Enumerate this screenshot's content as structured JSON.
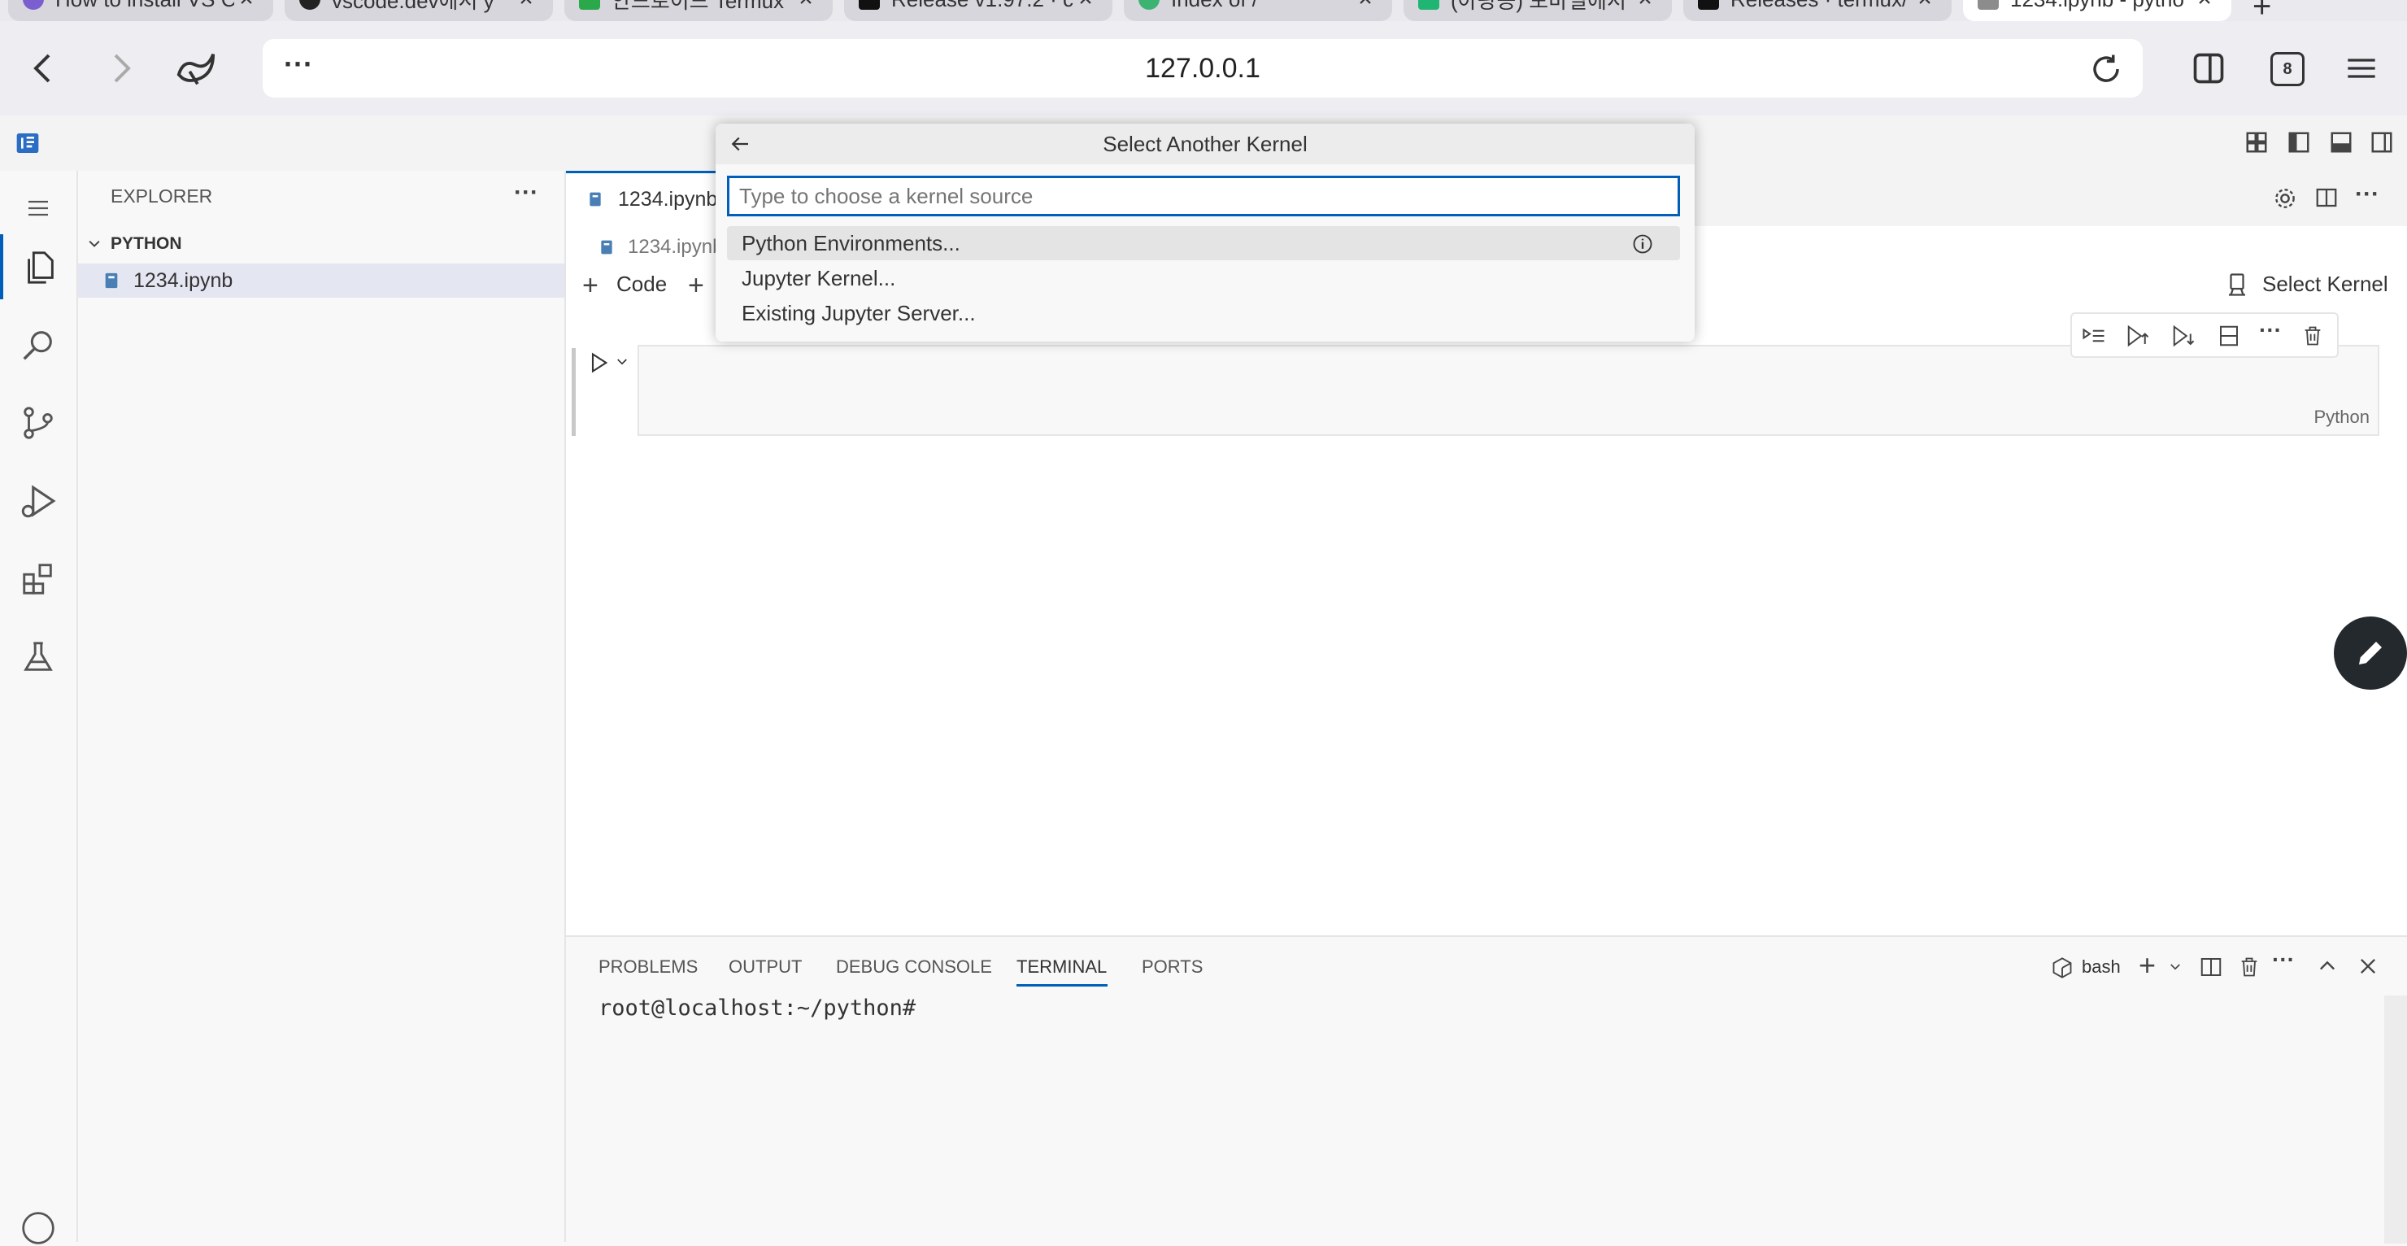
{
  "browser": {
    "tabs": [
      {
        "title": "How to install VS C",
        "favicon_color": "#7b5fd1"
      },
      {
        "title": "vscode.dev에서 y",
        "favicon_color": "#222222"
      },
      {
        "title": "안드로이드 Termux",
        "favicon_color": "#2aa84a"
      },
      {
        "title": "Release v1.97.2 · c",
        "favicon_color": "#111111"
      },
      {
        "title": "Index of /",
        "favicon_color": "#3cb371"
      },
      {
        "title": "(아팡공) 모바일에서",
        "favicon_color": "#21b573"
      },
      {
        "title": "Releases · termux/",
        "favicon_color": "#111111"
      },
      {
        "title": "1234.ipynb - pytho",
        "favicon_color": "#8c8c8c"
      }
    ],
    "new_tab_glyph": "+",
    "url": "127.0.0.1",
    "tab_count": "8",
    "menu_glyph": "⋯"
  },
  "sidebar": {
    "header": "EXPLORER",
    "folder": "PYTHON",
    "files": [
      "1234.ipynb"
    ]
  },
  "editor": {
    "tab_label": "1234.ipynb",
    "breadcrumb": "1234.ipynb",
    "add_code_label": "Code",
    "select_kernel_label": "Select Kernel",
    "cell_language": "Python"
  },
  "quick_pick": {
    "title": "Select Another Kernel",
    "placeholder": "Type to choose a kernel source",
    "items": [
      "Python Environments...",
      "Jupyter Kernel...",
      "Existing Jupyter Server..."
    ]
  },
  "panel": {
    "tabs": [
      "PROBLEMS",
      "OUTPUT",
      "DEBUG CONSOLE",
      "TERMINAL",
      "PORTS"
    ],
    "active_tab": "TERMINAL",
    "shell_label": "bash",
    "terminal_prompt": "root@localhost:~/python#"
  },
  "colors": {
    "accent": "#005fb8",
    "active_editor_bg": "#ffffff",
    "panel_bg": "#f8f8f8"
  },
  "icons": [
    "back-arrow-icon",
    "forward-arrow-icon",
    "browser-logo-icon",
    "reload-icon",
    "split-view-icon",
    "hamburger-menu-icon",
    "vscode-logo-icon",
    "files-icon",
    "search-icon",
    "source-control-icon",
    "run-debug-icon",
    "extensions-icon",
    "testing-icon",
    "info-icon",
    "trash-icon",
    "edit-pencil-icon"
  ]
}
